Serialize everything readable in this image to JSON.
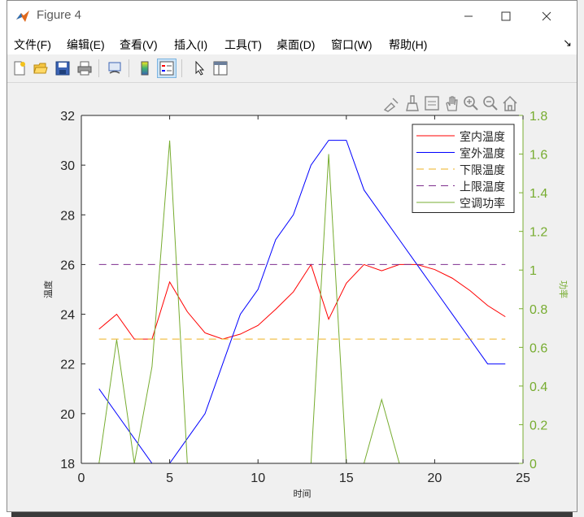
{
  "window": {
    "title": "Figure 4",
    "minimize_icon": "minimize-icon",
    "maximize_icon": "maximize-icon",
    "close_icon": "close-icon"
  },
  "menu": {
    "items": [
      "文件(F)",
      "编辑(E)",
      "查看(V)",
      "插入(I)",
      "工具(T)",
      "桌面(D)",
      "窗口(W)",
      "帮助(H)"
    ],
    "overflow_arrow": "↘"
  },
  "toolbar": {
    "icons": [
      "new-figure-icon",
      "open-file-icon",
      "save-icon",
      "print-icon",
      "link-plot-icon",
      "insert-colorbar-icon",
      "insert-legend-icon",
      "edit-plot-icon",
      "property-inspector-icon"
    ]
  },
  "axes_toolbar": {
    "icons": [
      "export-icon",
      "brush-icon",
      "data-tips-icon",
      "pan-icon",
      "zoom-in-icon",
      "zoom-out-icon",
      "home-icon"
    ]
  },
  "chart_data": {
    "type": "line",
    "xlabel": "时间",
    "ylabel_left": "温度",
    "ylabel_right": "功率",
    "xlim": [
      0,
      25
    ],
    "ylim_left": [
      18,
      32
    ],
    "ylim_right": [
      0,
      1.8
    ],
    "xticks": [
      "0",
      "5",
      "10",
      "15",
      "20",
      "25"
    ],
    "yticks_left": [
      "18",
      "20",
      "22",
      "24",
      "26",
      "28",
      "30",
      "32"
    ],
    "yticks_right": [
      "0",
      "0.2",
      "0.4",
      "0.6",
      "0.8",
      "1",
      "1.2",
      "1.4",
      "1.6",
      "1.8"
    ],
    "grid": false,
    "legend_position": "top-right",
    "colors": {
      "indoor": "#ff0000",
      "outdoor": "#0000ff",
      "lower": "#edb120",
      "upper": "#7e2f8e",
      "power": "#77ac30",
      "right_axis": "#77ac30"
    },
    "x": [
      1,
      2,
      3,
      4,
      5,
      6,
      7,
      8,
      9,
      10,
      11,
      12,
      13,
      14,
      15,
      16,
      17,
      18,
      19,
      20,
      21,
      22,
      23,
      24
    ],
    "series": [
      {
        "name": "室内温度",
        "axis": "left",
        "style": "solid",
        "color": "#ff0000",
        "values": [
          23.4,
          24.0,
          23.0,
          23.0,
          25.3,
          24.1,
          23.25,
          23.0,
          23.2,
          23.55,
          24.2,
          24.9,
          26.0,
          23.8,
          25.25,
          26.0,
          25.75,
          26.0,
          26.0,
          25.8,
          25.45,
          24.95,
          24.35,
          23.9
        ]
      },
      {
        "name": "室外温度",
        "axis": "left",
        "style": "solid",
        "color": "#0000ff",
        "values": [
          21.0,
          20.0,
          19.0,
          18.0,
          18.0,
          19.0,
          20.0,
          22.0,
          24.0,
          25.0,
          27.0,
          28.0,
          30.0,
          31.0,
          31.0,
          29.0,
          28.0,
          27.0,
          26.0,
          25.0,
          24.0,
          23.0,
          22.0,
          22.0
        ]
      },
      {
        "name": "下限温度",
        "axis": "left",
        "style": "dashed",
        "color": "#edb120",
        "values": [
          23,
          23,
          23,
          23,
          23,
          23,
          23,
          23,
          23,
          23,
          23,
          23,
          23,
          23,
          23,
          23,
          23,
          23,
          23,
          23,
          23,
          23,
          23,
          23
        ]
      },
      {
        "name": "上限温度",
        "axis": "left",
        "style": "dashed",
        "color": "#7e2f8e",
        "values": [
          26,
          26,
          26,
          26,
          26,
          26,
          26,
          26,
          26,
          26,
          26,
          26,
          26,
          26,
          26,
          26,
          26,
          26,
          26,
          26,
          26,
          26,
          26,
          26
        ]
      },
      {
        "name": "空调功率",
        "axis": "right",
        "style": "solid",
        "color": "#77ac30",
        "values": [
          0,
          0.64,
          0,
          0.5,
          1.67,
          0,
          0,
          0,
          0,
          0,
          0,
          0,
          0,
          1.6,
          0,
          0,
          0.33,
          0,
          0,
          0,
          0,
          0,
          0,
          0
        ]
      }
    ]
  }
}
